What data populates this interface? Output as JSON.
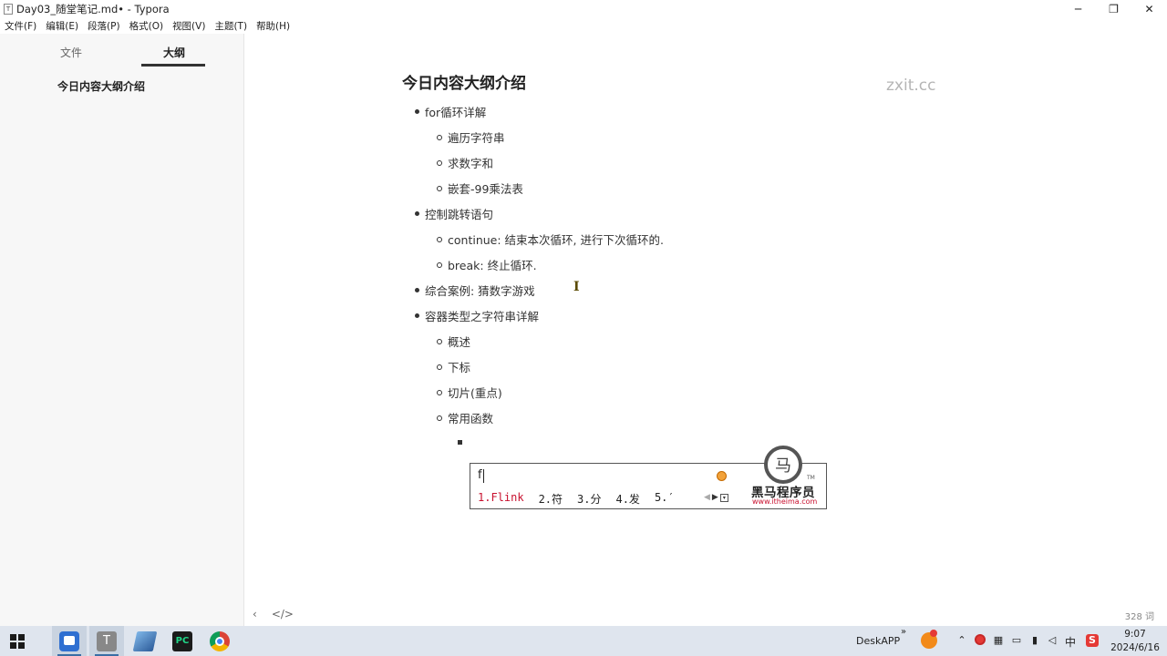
{
  "window": {
    "title": "Day03_随堂笔记.md• - Typora",
    "app_icon": "T",
    "minimize": "─",
    "restore": "❐",
    "close": "✕"
  },
  "menu": [
    "文件(F)",
    "编辑(E)",
    "段落(P)",
    "格式(O)",
    "视图(V)",
    "主题(T)",
    "帮助(H)"
  ],
  "sidebar": {
    "tabs": [
      "文件",
      "大纲"
    ],
    "active_tab": "大纲",
    "outline_items": [
      "今日内容大纲介绍"
    ]
  },
  "document": {
    "heading": "今日内容大纲介绍",
    "watermark": "zxit.cc",
    "items": [
      {
        "level": 1,
        "text": "for循环详解"
      },
      {
        "level": 2,
        "text": "遍历字符串"
      },
      {
        "level": 2,
        "text": "求数字和"
      },
      {
        "level": 2,
        "text": "嵌套-99乘法表"
      },
      {
        "level": 1,
        "text": "控制跳转语句"
      },
      {
        "level": 2,
        "text": "continue: 结束本次循环, 进行下次循环的."
      },
      {
        "level": 2,
        "text": "break: 终止循环."
      },
      {
        "level": 1,
        "text": "综合案例: 猜数字游戏"
      },
      {
        "level": 1,
        "text": "容器类型之字符串详解"
      },
      {
        "level": 2,
        "text": "概述"
      },
      {
        "level": 2,
        "text": "下标"
      },
      {
        "level": 2,
        "text": "切片(重点)"
      },
      {
        "level": 2,
        "text": "常用函数"
      },
      {
        "level": 3,
        "text": ""
      }
    ]
  },
  "footer": {
    "back_icon": "‹",
    "source_icon": "</>",
    "word_count": "328 词"
  },
  "ime": {
    "input": "f",
    "candidates": [
      "1.Flink",
      "2.符",
      "3.分",
      "4.发",
      "5.′"
    ],
    "logo_text": "黑马程序员",
    "logo_url": "www.itheima.com",
    "logo_tm": "TM"
  },
  "taskbar": {
    "deskapp_label": "DeskAPP",
    "more_label": "»",
    "ime_lang": "中",
    "time": "9:07",
    "date": "2024/6/16"
  }
}
